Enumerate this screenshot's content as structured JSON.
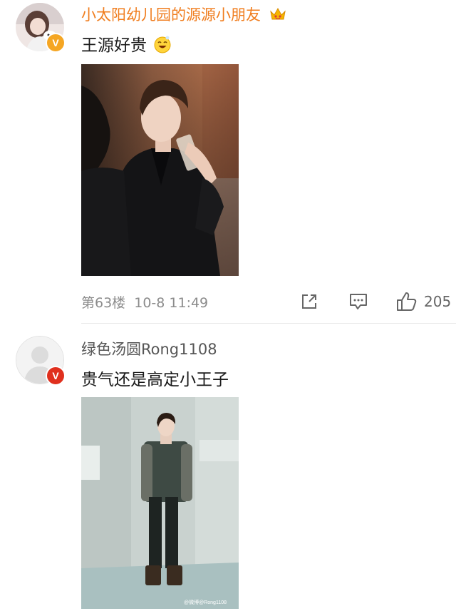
{
  "comments": [
    {
      "username": "小太阳幼儿园的源源小朋友",
      "username_color": "#f07d1e",
      "crown_icon": "crown-emoji-icon",
      "badge_color": "#f5a623",
      "badge_label": "V",
      "text": "王源好贵",
      "emoji_icon": "smiling-emoji-icon",
      "image_icon": "photo-drinking-water",
      "floor": "第63楼",
      "time": "10-8 11:49",
      "share_icon": "share-icon",
      "reply_icon": "comment-icon",
      "like_icon": "thumbs-up-icon",
      "likes": "205"
    },
    {
      "username": "绿色汤圆Rong1108",
      "username_color": "#555555",
      "badge_color": "#e0301e",
      "badge_label": "V",
      "text": "贵气还是高定小王子",
      "image_icon": "photo-full-body",
      "watermark": "@微博@Rong1108"
    }
  ]
}
